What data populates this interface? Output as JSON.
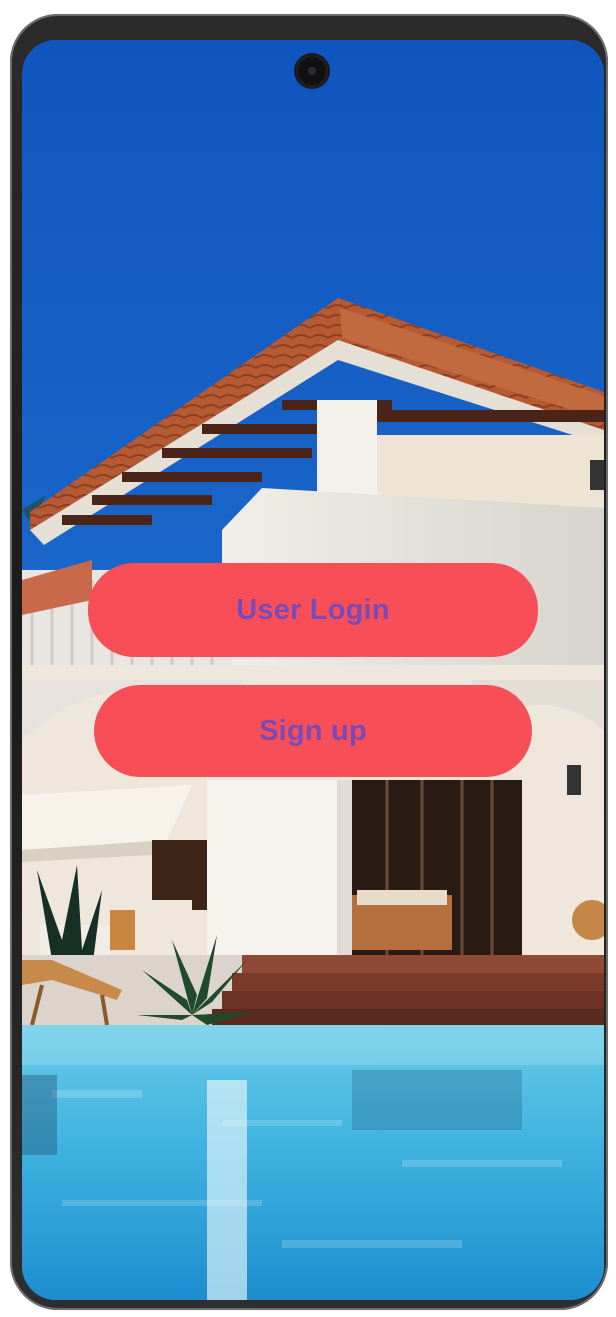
{
  "auth": {
    "login_label": "User Login",
    "signup_label": "Sign up"
  },
  "colors": {
    "button_bg": "#f74e57",
    "button_text": "#7a4bb8",
    "sky": "#1863c8",
    "pool": "#49b8e2"
  },
  "background": {
    "icon": "villa-pool-photo"
  }
}
